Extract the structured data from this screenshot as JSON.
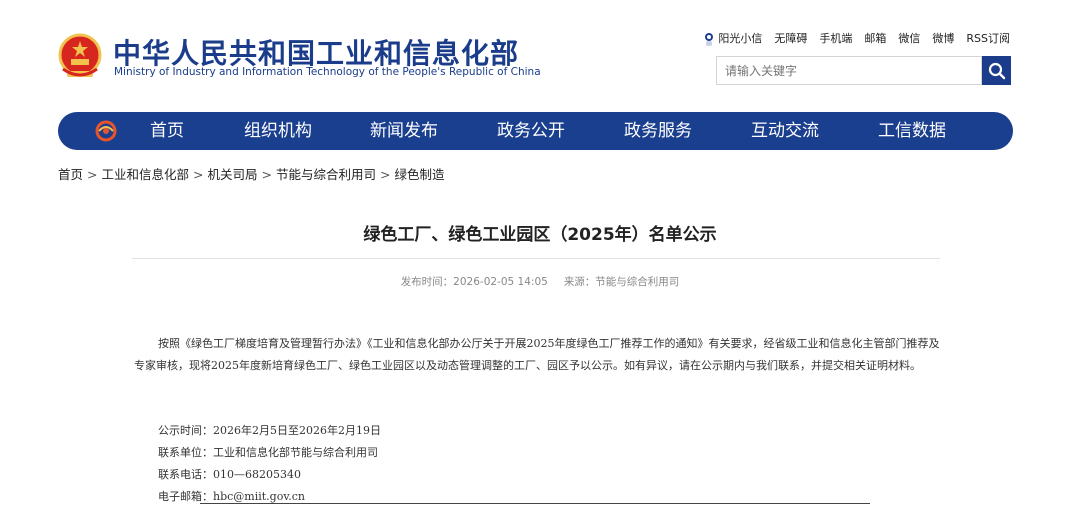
{
  "header": {
    "site_title_cn": "中华人民共和国工业和信息化部",
    "site_title_en": "Ministry of Industry and Information Technology of the People's Republic of China",
    "top_links": [
      "阳光小信",
      "无障碍",
      "手机端",
      "邮箱",
      "微信",
      "微博",
      "RSS订阅"
    ],
    "search": {
      "placeholder": "请输入关键字",
      "icon": "search-icon"
    }
  },
  "nav": {
    "items": [
      "首页",
      "组织机构",
      "新闻发布",
      "政务公开",
      "政务服务",
      "互动交流",
      "工信数据"
    ]
  },
  "breadcrumb": [
    "首页",
    "工业和信息化部",
    "机关司局",
    "节能与综合利用司",
    "绿色制造"
  ],
  "article": {
    "title": "绿色工厂、绿色工业园区（2025年）名单公示",
    "publish_time": "发布时间：2026-02-05 14:05",
    "source": "来源：节能与综合利用司",
    "paragraph": "按照《绿色工厂梯度培育及管理暂行办法》《工业和信息化部办公厅关于开展2025年度绿色工厂推荐工作的通知》有关要求，经省级工业和信息化主管部门推荐及专家审核，现将2025年度新培育绿色工厂、绿色工业园区以及动态管理调整的工厂、园区予以公示。如有异议，请在公示期内与我们联系，并提交相关证明材料。",
    "info": [
      "公示时间：2026年2月5日至2026年2月19日",
      "联系单位：工业和信息化部节能与综合利用司",
      "联系电话：010—68205340",
      "电子邮箱：hbc@miit.gov.cn"
    ]
  },
  "colors": {
    "brand_blue": "#1b3f8f",
    "emblem_red": "#d7261e",
    "emblem_gold": "#f2c14e"
  }
}
